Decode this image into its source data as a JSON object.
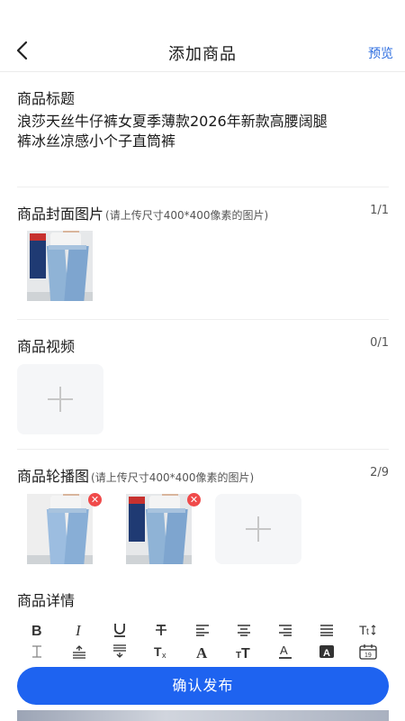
{
  "header": {
    "title": "添加商品",
    "preview_label": "预览"
  },
  "product_title": {
    "label": "商品标题",
    "value_line1": "浪莎天丝牛仔裤女夏季薄款2026年新款高腰阔腿",
    "value_line2": "裤冰丝凉感小个子直筒裤"
  },
  "cover_image": {
    "label": "商品封面图片",
    "hint": "(请上传尺寸400*400像素的图片)",
    "count": "1/1"
  },
  "video": {
    "label": "商品视频",
    "count": "0/1"
  },
  "carousel": {
    "label": "商品轮播图",
    "hint": "(请上传尺寸400*400像素的图片)",
    "count": "2/9"
  },
  "details": {
    "label": "商品详情",
    "toolbar_row1": [
      "bold-icon",
      "italic-icon",
      "underline-icon",
      "strikethrough-icon",
      "align-left-icon",
      "align-center-icon",
      "align-right-icon",
      "align-justify-icon",
      "text-size-icon"
    ],
    "toolbar_row2": [
      "line-height-icon",
      "paragraph-spacing-up-icon",
      "paragraph-spacing-down-icon",
      "clear-format-icon",
      "font-family-icon",
      "font-size-icon",
      "font-color-icon",
      "background-color-icon",
      "insert-date-icon"
    ]
  },
  "submit": {
    "label": "确认发布"
  },
  "colors": {
    "accent": "#1e63f0",
    "link": "#2f6fe0",
    "remove_badge": "#f04a4a"
  }
}
